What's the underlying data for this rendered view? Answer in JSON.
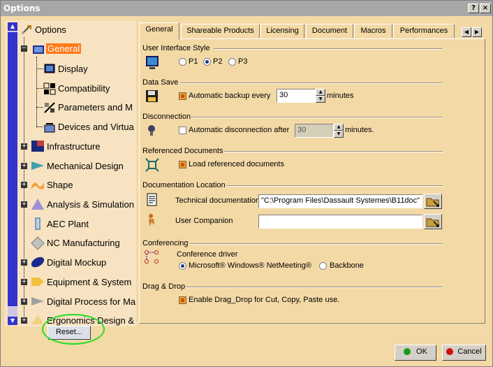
{
  "window": {
    "title": "Options",
    "help_label": "?",
    "close_label": "×"
  },
  "tree": {
    "root": "Options",
    "items": [
      {
        "label": "General"
      },
      {
        "label": "Display"
      },
      {
        "label": "Compatibility"
      },
      {
        "label": "Parameters and M"
      },
      {
        "label": "Devices and Virtua"
      },
      {
        "label": "Infrastructure"
      },
      {
        "label": "Mechanical Design"
      },
      {
        "label": "Shape"
      },
      {
        "label": "Analysis & Simulation"
      },
      {
        "label": "AEC Plant"
      },
      {
        "label": "NC Manufacturing"
      },
      {
        "label": "Digital Mockup"
      },
      {
        "label": "Equipment & System"
      },
      {
        "label": "Digital Process for Ma"
      },
      {
        "label": "Ergonomics Design &"
      }
    ],
    "reset_label": "Reset..."
  },
  "tabs": [
    {
      "label": "General"
    },
    {
      "label": "Shareable Products"
    },
    {
      "label": "Licensing"
    },
    {
      "label": "Document"
    },
    {
      "label": "Macros"
    },
    {
      "label": "Performances"
    }
  ],
  "ui_style": {
    "title": "User Interface Style",
    "options": [
      "P1",
      "P2",
      "P3"
    ],
    "selected": "P2"
  },
  "data_save": {
    "title": "Data Save",
    "auto_backup_label": "Automatic backup every",
    "auto_backup_checked": true,
    "value": "30",
    "unit": "minutes"
  },
  "disconnection": {
    "title": "Disconnection",
    "label": "Automatic disconnection after",
    "checked": false,
    "value": "30",
    "unit": "minutes."
  },
  "referenced_docs": {
    "title": "Referenced Documents",
    "label": "Load referenced documents",
    "checked": true
  },
  "doc_location": {
    "title": "Documentation Location",
    "tech_label": "Technical documentation",
    "tech_value": "\"C:\\Program Files\\Dassault Systemes\\B11doc\"",
    "companion_label": "User Companion",
    "companion_value": ""
  },
  "conferencing": {
    "title": "Conferencing",
    "driver_label": "Conference driver",
    "options": [
      "Microsoft® Windows® NetMeeting®",
      "Backbone"
    ],
    "selected": "Microsoft® Windows® NetMeeting®"
  },
  "drag_drop": {
    "title": "Drag & Drop",
    "label": "Enable Drag_Drop for Cut, Copy, Paste use.",
    "checked": true
  },
  "buttons": {
    "ok": "OK",
    "cancel": "Cancel"
  },
  "colors": {
    "background": "#f3d9a6",
    "selection": "#ff7a1a",
    "scrollbar": "#3333cc",
    "highlight_ellipse": "#22dd22"
  }
}
